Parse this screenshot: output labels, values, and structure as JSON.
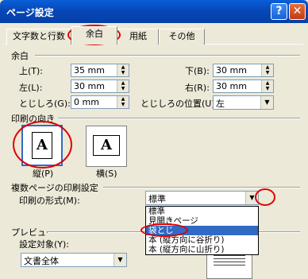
{
  "window": {
    "title": "ページ設定",
    "help_glyph": "?",
    "close_glyph": "✕"
  },
  "tabs": [
    {
      "label": "文字数と行数"
    },
    {
      "label": "余白"
    },
    {
      "label": "用紙"
    },
    {
      "label": "その他"
    }
  ],
  "margins": {
    "section": "余白",
    "top_label": "上(T):",
    "top_value": "35 mm",
    "bottom_label": "下(B):",
    "bottom_value": "30 mm",
    "left_label": "左(L):",
    "left_value": "30 mm",
    "right_label": "右(R):",
    "right_value": "30 mm",
    "gutter_label": "とじしろ(G):",
    "gutter_value": "0 mm",
    "gutter_pos_label": "とじしろの位置(U):",
    "gutter_pos_value": "左"
  },
  "orientation": {
    "section": "印刷の向き",
    "portrait_label": "縦(P)",
    "landscape_label": "横(S)",
    "page_glyph": "A"
  },
  "multipage": {
    "section": "複数ページの印刷設定",
    "format_label": "印刷の形式(M):",
    "format_value": "標準",
    "options": [
      "標準",
      "見開きページ",
      "袋とじ",
      "本 (縦方向に谷折り)",
      "本 (縦方向に山折り)"
    ],
    "selected_index": 2
  },
  "preview": {
    "section": "プレビュー",
    "apply_label": "設定対象(Y):",
    "apply_value": "文書全体"
  },
  "colors": {
    "titlebar": "#0a5fd8",
    "highlight": "#316ac5",
    "annotation": "#e00000",
    "dialog_bg": "#ece9d8"
  }
}
